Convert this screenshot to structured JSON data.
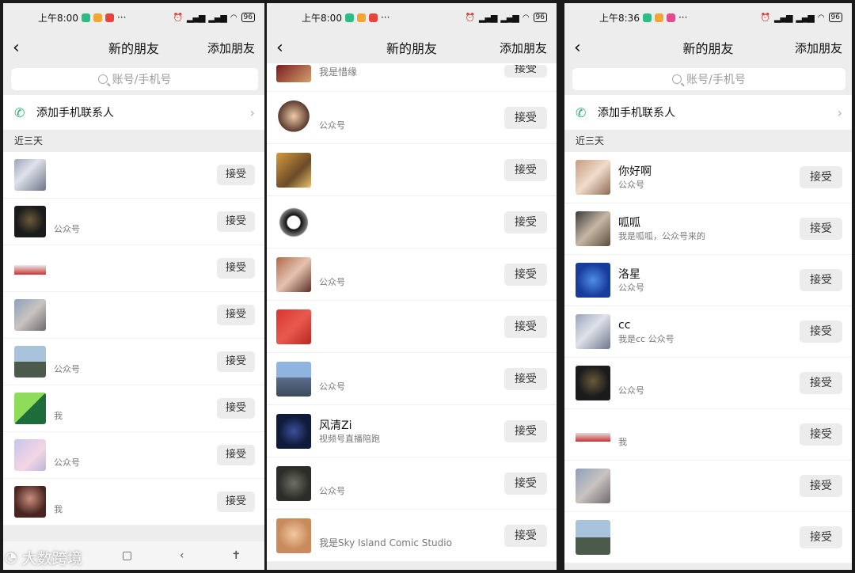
{
  "screens": [
    {
      "status": {
        "time": "上午8:00",
        "battery": "96"
      },
      "nav": {
        "title": "新的朋友",
        "add": "添加朋友"
      },
      "search_placeholder": "账号/手机号",
      "add_phone_label": "添加手机联系人",
      "section_label": "近三天",
      "accept_label": "接受",
      "rows": [
        {
          "name": "",
          "sub": ""
        },
        {
          "name": "",
          "sub": "公众号"
        },
        {
          "name": "",
          "sub": ""
        },
        {
          "name": "",
          "sub": ""
        },
        {
          "name": "",
          "sub": "公众号"
        },
        {
          "name": "",
          "sub": "我"
        },
        {
          "name": "",
          "sub": "公众号"
        },
        {
          "name": "",
          "sub": "我"
        }
      ]
    },
    {
      "status": {
        "time": "上午8:00",
        "battery": "96"
      },
      "nav": {
        "title": "新的朋友",
        "add": "添加朋友"
      },
      "accept_label": "接受",
      "top_partial_sub": "我是惜缘",
      "rows": [
        {
          "name": "",
          "sub": "公众号"
        },
        {
          "name": "",
          "sub": ""
        },
        {
          "name": "",
          "sub": ""
        },
        {
          "name": "",
          "sub": "公众号"
        },
        {
          "name": "",
          "sub": ""
        },
        {
          "name": "",
          "sub": "公众号"
        },
        {
          "name": "风清Zi",
          "sub": "视频号直播陪跑"
        },
        {
          "name": "",
          "sub": "公众号"
        },
        {
          "name": "",
          "sub": "我是Sky Island Comic Studio"
        }
      ]
    },
    {
      "status": {
        "time": "上午8:36",
        "battery": "96"
      },
      "nav": {
        "title": "新的朋友",
        "add": "添加朋友"
      },
      "search_placeholder": "账号/手机号",
      "add_phone_label": "添加手机联系人",
      "section_label": "近三天",
      "accept_label": "接受",
      "rows": [
        {
          "name": "你好啊",
          "sub": "公众号"
        },
        {
          "name": "呱呱",
          "sub": "我是呱呱，公众号来的"
        },
        {
          "name": "洛星",
          "sub": "公众号"
        },
        {
          "name": "cc",
          "sub": "我是cc 公众号"
        },
        {
          "name": "",
          "sub": "公众号"
        },
        {
          "name": "",
          "sub": "我"
        },
        {
          "name": "",
          "sub": ""
        },
        {
          "name": "",
          "sub": ""
        }
      ]
    }
  ],
  "watermark": "大数跨境",
  "colors": {
    "background": "#ededed",
    "accent_green": "#2aae67",
    "accept_button": "#ececec"
  }
}
